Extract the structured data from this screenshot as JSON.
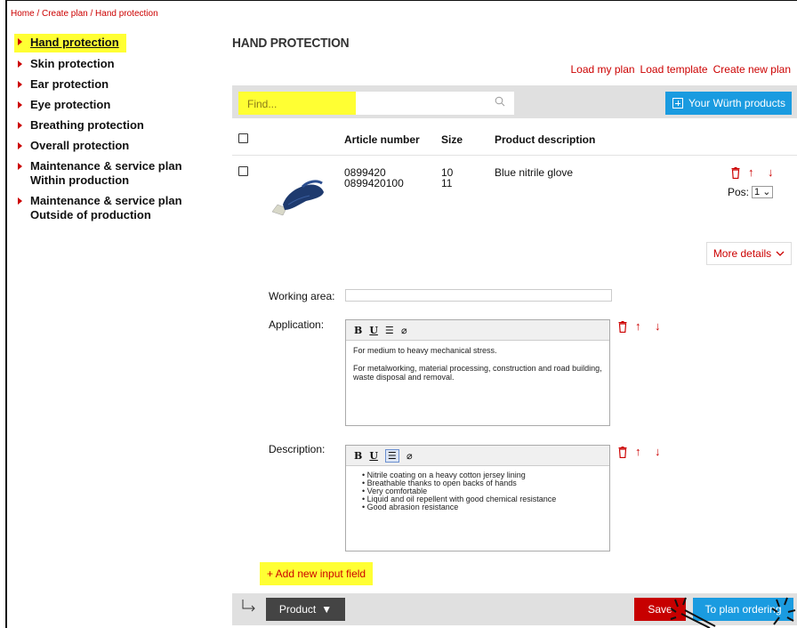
{
  "breadcrumb": "Home / Create plan / Hand protection",
  "sidebar": {
    "items": [
      {
        "label": "Hand protection"
      },
      {
        "label": "Skin protection"
      },
      {
        "label": "Ear protection"
      },
      {
        "label": "Eye protection"
      },
      {
        "label": "Breathing protection"
      },
      {
        "label": "Overall protection"
      },
      {
        "label": "Maintenance & service plan",
        "label2": "Within production"
      },
      {
        "label": "Maintenance & service plan",
        "label2": "Outside of production"
      }
    ]
  },
  "page_title": "HAND PROTECTION",
  "top_links": {
    "load_plan": "Load my plan",
    "load_template": "Load template",
    "create_new": "Create new plan"
  },
  "search": {
    "placeholder": "Find...",
    "wurth_button": "Your Würth products"
  },
  "table": {
    "headers": {
      "article": "Article number",
      "size": "Size",
      "description": "Product description"
    },
    "row": {
      "articles": [
        "0899420",
        "0899420100"
      ],
      "sizes": [
        "10",
        "11"
      ],
      "description": "Blue nitrile glove",
      "pos_label": "Pos:",
      "pos_value": "1"
    }
  },
  "more_details": "More details",
  "form": {
    "working_area_label": "Working area:",
    "application_label": "Application:",
    "application_text": [
      "For medium to heavy mechanical stress.",
      "For metalworking, material processing, construction and road building, waste disposal and removal."
    ],
    "description_label": "Description:",
    "description_items": [
      "Nitrile coating on a heavy cotton jersey lining",
      "Breathable thanks to open backs of hands",
      "Very comfortable",
      "Liquid and oil repellent with good chemical resistance",
      "Good abrasion resistance"
    ]
  },
  "add_field": "+ Add new input field",
  "footer": {
    "product_button": "Product",
    "save_button": "Save",
    "order_button": "To plan ordering"
  },
  "colors": {
    "accent_red": "#c70000",
    "accent_blue": "#1a9be0",
    "highlight": "#ffff33"
  }
}
